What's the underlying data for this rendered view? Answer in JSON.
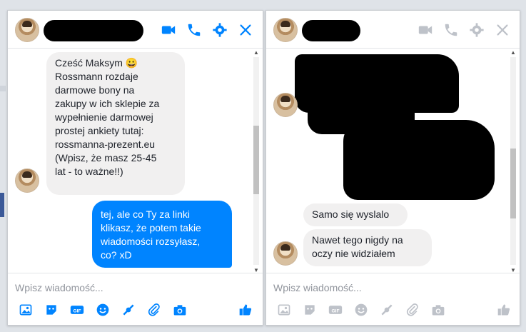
{
  "left_chat": {
    "header_icons": [
      "video-camera-icon",
      "phone-icon",
      "gear-icon",
      "close-icon"
    ],
    "messages": [
      {
        "from": "contact",
        "lines": [
          "Cześć Maksym 😀",
          "Rossmann rozdaje",
          "darmowe bony na",
          "zakupy w ich sklepie za",
          "wypełnienie darmowej",
          "prostej ankiety tutaj:",
          "rossmanna-prezent.eu",
          "(Wpisz, że masz 25-45",
          "lat - to ważne!!)"
        ]
      },
      {
        "from": "me",
        "lines": [
          "tej, ale co Ty za linki",
          "klikasz, że potem takie",
          "wiadomości rozsyłasz,",
          "co? xD"
        ]
      }
    ],
    "composer_placeholder": "Wpisz wiadomość...",
    "toolbar_icons": [
      "image-icon",
      "sticker-icon",
      "gif-icon",
      "emoji-icon",
      "game-icon",
      "attachment-icon",
      "camera-icon",
      "thumbs-up-icon"
    ],
    "accent_color": "#0084ff"
  },
  "right_chat": {
    "header_icons": [
      "video-camera-icon",
      "phone-icon",
      "gear-icon",
      "close-icon"
    ],
    "messages": [
      {
        "from": "me",
        "lines": [
          "Samo się wyslalo"
        ]
      },
      {
        "from": "me",
        "lines": [
          "Nawet tego nigdy na",
          "oczy nie widziałem"
        ]
      }
    ],
    "composer_placeholder": "Wpisz wiadomość...",
    "toolbar_icons": [
      "image-icon",
      "sticker-icon",
      "gif-icon",
      "emoji-icon",
      "game-icon",
      "attachment-icon",
      "camera-icon",
      "thumbs-up-icon"
    ],
    "icon_color": "#bec2c9"
  }
}
